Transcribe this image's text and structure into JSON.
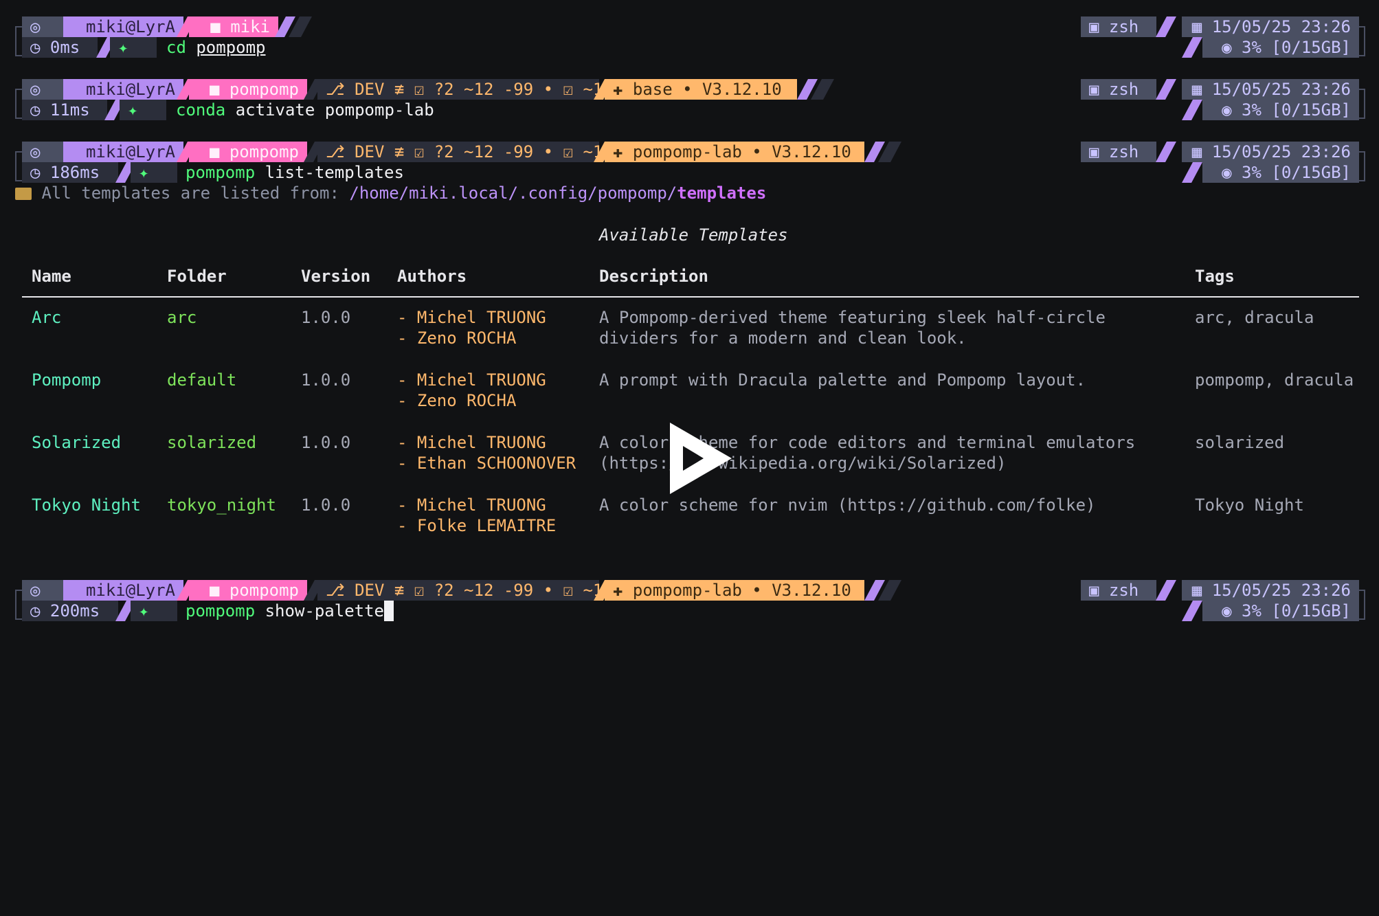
{
  "prompts": [
    {
      "top_icon": "◎",
      "user": "miki@LyrA",
      "dir_icon": "■",
      "dir": "miki",
      "git": null,
      "env": null,
      "time_icon": "◷",
      "duration": "0ms",
      "arrow_icon": "✦",
      "command": "cd",
      "arg": "pompomp",
      "arg_underline": true,
      "shell_icon": "▣",
      "shell": "zsh",
      "clock_icon": "▦",
      "datetime": "15/05/25 23:26",
      "mem_icon": "◉",
      "mem": "3% [0/15GB]"
    },
    {
      "top_icon": "◎",
      "user": "miki@LyrA",
      "dir_icon": "■",
      "dir": "pompomp",
      "git": "⎇ DEV ≢ ☑ ?2 ~12 -99 • ☑ ~1",
      "env": "✚ base • V3.12.10",
      "time_icon": "◷",
      "duration": "11ms",
      "arrow_icon": "✦",
      "command": "conda",
      "arg": "activate pompomp-lab",
      "arg_underline": false,
      "shell_icon": "▣",
      "shell": "zsh",
      "clock_icon": "▦",
      "datetime": "15/05/25 23:26",
      "mem_icon": "◉",
      "mem": "3% [0/15GB]"
    },
    {
      "top_icon": "◎",
      "user": "miki@LyrA",
      "dir_icon": "■",
      "dir": "pompomp",
      "git": "⎇ DEV ≢ ☑ ?2 ~12 -99 • ☑ ~1",
      "env": "✚ pompomp-lab • V3.12.10",
      "time_icon": "◷",
      "duration": "186ms",
      "arrow_icon": "✦",
      "command": "pompomp",
      "arg": "list-templates",
      "arg_underline": false,
      "shell_icon": "▣",
      "shell": "zsh",
      "clock_icon": "▦",
      "datetime": "15/05/25 23:26",
      "mem_icon": "◉",
      "mem": "3% [0/15GB]"
    },
    {
      "top_icon": "◎",
      "user": "miki@LyrA",
      "dir_icon": "■",
      "dir": "pompomp",
      "git": "⎇ DEV ≢ ☑ ?2 ~12 -99 • ☑ ~1",
      "env": "✚ pompomp-lab • V3.12.10",
      "time_icon": "◷",
      "duration": "200ms",
      "arrow_icon": "✦",
      "command": "pompomp",
      "arg": "show-palette",
      "arg_underline": false,
      "shell_icon": "▣",
      "shell": "zsh",
      "clock_icon": "▦",
      "datetime": "15/05/25 23:26",
      "mem_icon": "◉",
      "mem": "3% [0/15GB]"
    }
  ],
  "listing": {
    "prefix": "All templates are listed from:",
    "path": "/home/miki.local/.config/pompomp/",
    "path_bold": "templates"
  },
  "table": {
    "title": "Available Templates",
    "headers": [
      "Name",
      "Folder",
      "Version",
      "Authors",
      "Description",
      "Tags"
    ],
    "rows": [
      {
        "name": "Arc",
        "folder": "arc",
        "version": "1.0.0",
        "authors": [
          "- Michel TRUONG",
          "- Zeno ROCHA"
        ],
        "description": [
          "A Pompomp-derived theme featuring sleek half-circle",
          "dividers for a modern and clean look."
        ],
        "tags": "arc, dracula"
      },
      {
        "name": "Pompomp",
        "folder": "default",
        "version": "1.0.0",
        "authors": [
          "- Michel TRUONG",
          "- Zeno ROCHA"
        ],
        "description": [
          "A prompt with Dracula palette and Pompomp layout.",
          ""
        ],
        "tags": "pompomp, dracula"
      },
      {
        "name": "Solarized",
        "folder": "solarized",
        "version": "1.0.0",
        "authors": [
          "- Michel TRUONG",
          "- Ethan SCHOONOVER"
        ],
        "description": [
          "A color scheme for code editors and terminal emulators",
          "(https://en.wikipedia.org/wiki/Solarized)"
        ],
        "tags": "solarized"
      },
      {
        "name": "Tokyo Night",
        "folder": "tokyo_night",
        "version": "1.0.0",
        "authors": [
          "- Michel TRUONG",
          "- Folke LEMAITRE"
        ],
        "description": [
          "A color scheme for nvim (https://github.com/folke)",
          ""
        ],
        "tags": "Tokyo Night"
      }
    ]
  },
  "colors": {
    "background": "#111214",
    "purple": "#b48cf2",
    "pink": "#ff6fc2",
    "orange": "#ffb86c",
    "green": "#50fa7b",
    "teal": "#5ef0c0"
  },
  "player": {
    "icon": "play-icon"
  }
}
